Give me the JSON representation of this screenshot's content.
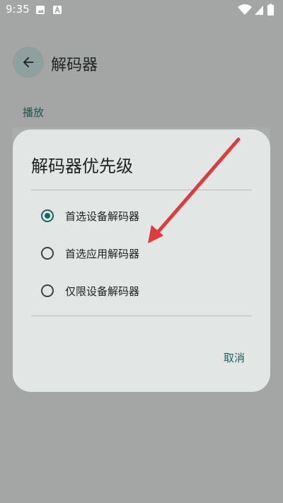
{
  "status_bar": {
    "time": "9:35"
  },
  "header": {
    "title": "解码器"
  },
  "section": {
    "label": "播放"
  },
  "dialog": {
    "title": "解码器优先级",
    "options": [
      {
        "label": "首选设备解码器",
        "selected": true
      },
      {
        "label": "首选应用解码器",
        "selected": false
      },
      {
        "label": "仅限设备解码器",
        "selected": false
      }
    ],
    "cancel_label": "取消"
  },
  "colors": {
    "accent": "#16665c",
    "annotation_arrow": "#e03a3a"
  },
  "icons": {
    "back": "arrow-left-icon",
    "gallery": "image-icon",
    "wifi": "wifi-icon",
    "signal": "signal-icon",
    "battery": "battery-icon"
  }
}
